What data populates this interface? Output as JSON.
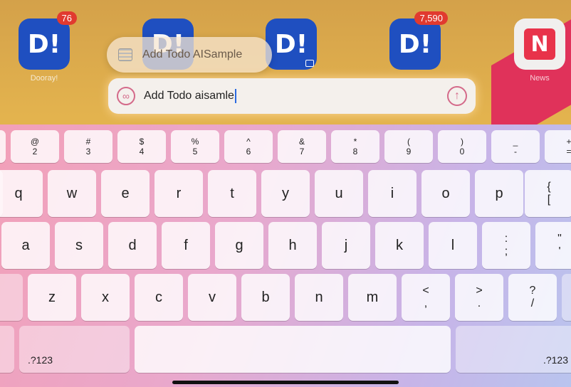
{
  "home_apps": [
    {
      "label": "Dooray!",
      "glyph": "D!",
      "badge": "76"
    },
    {
      "label": "",
      "glyph": "D!",
      "badge": ""
    },
    {
      "label": "",
      "glyph": "D!",
      "badge": ""
    },
    {
      "label": "",
      "glyph": "D!",
      "badge": "7,590"
    },
    {
      "label": "News",
      "glyph": "N",
      "badge": ""
    }
  ],
  "suggestion": {
    "label": "Add Todo AISample"
  },
  "input": {
    "value": "Add Todo aisamle"
  },
  "keyboard": {
    "number_row": [
      {
        "top": "@",
        "bottom": "2"
      },
      {
        "top": "#",
        "bottom": "3"
      },
      {
        "top": "$",
        "bottom": "4"
      },
      {
        "top": "%",
        "bottom": "5"
      },
      {
        "top": "^",
        "bottom": "6"
      },
      {
        "top": "&",
        "bottom": "7"
      },
      {
        "top": "*",
        "bottom": "8"
      },
      {
        "top": "(",
        "bottom": "9"
      },
      {
        "top": ")",
        "bottom": "0"
      },
      {
        "top": "_",
        "bottom": "-"
      },
      {
        "top": "+",
        "bottom": "="
      }
    ],
    "row_q": [
      "q",
      "w",
      "e",
      "r",
      "t",
      "y",
      "u",
      "i",
      "o",
      "p"
    ],
    "row_q_extra": {
      "top": "{",
      "bottom": "["
    },
    "row_a": [
      "a",
      "s",
      "d",
      "f",
      "g",
      "h",
      "j",
      "k",
      "l"
    ],
    "row_a_semicolon": {
      "top": ":",
      "bottom": ";"
    },
    "row_a_quote": {
      "top": "\"",
      "bottom": "'"
    },
    "row_z": [
      "z",
      "x",
      "c",
      "v",
      "b",
      "n",
      "m"
    ],
    "row_z_comma": {
      "top": "<",
      "bottom": ","
    },
    "row_z_period": {
      "top": ">",
      "bottom": "."
    },
    "row_z_slash": {
      "top": "?",
      "bottom": "/"
    },
    "mode_left": ".?123",
    "mode_right": ".?123"
  }
}
